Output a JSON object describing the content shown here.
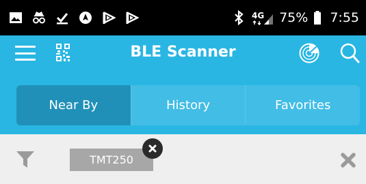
{
  "status_bar": {
    "icons": [
      "image-icon",
      "incognito-icon",
      "download-check-icon",
      "navigation-icon",
      "flag-icon",
      "flag-icon"
    ],
    "network": "4G",
    "battery": "75%",
    "time": "7:55"
  },
  "app_bar": {
    "title": "BLE Scanner",
    "icons": [
      "menu-icon",
      "qr-code-icon",
      "radar-icon",
      "search-icon"
    ]
  },
  "tabs": [
    {
      "label": "Near By",
      "active": true
    },
    {
      "label": "History",
      "active": false
    },
    {
      "label": "Favorites",
      "active": false
    }
  ],
  "filter": {
    "chip_label": "TMT250",
    "icons": [
      "filter-icon",
      "chip-close-icon",
      "clear-filter-icon"
    ]
  },
  "colors": {
    "primary": "#29b6e3",
    "active_tab": "#2190b8",
    "status_bar": "#000000",
    "chip": "#a7a7a7",
    "background": "#efefef"
  }
}
